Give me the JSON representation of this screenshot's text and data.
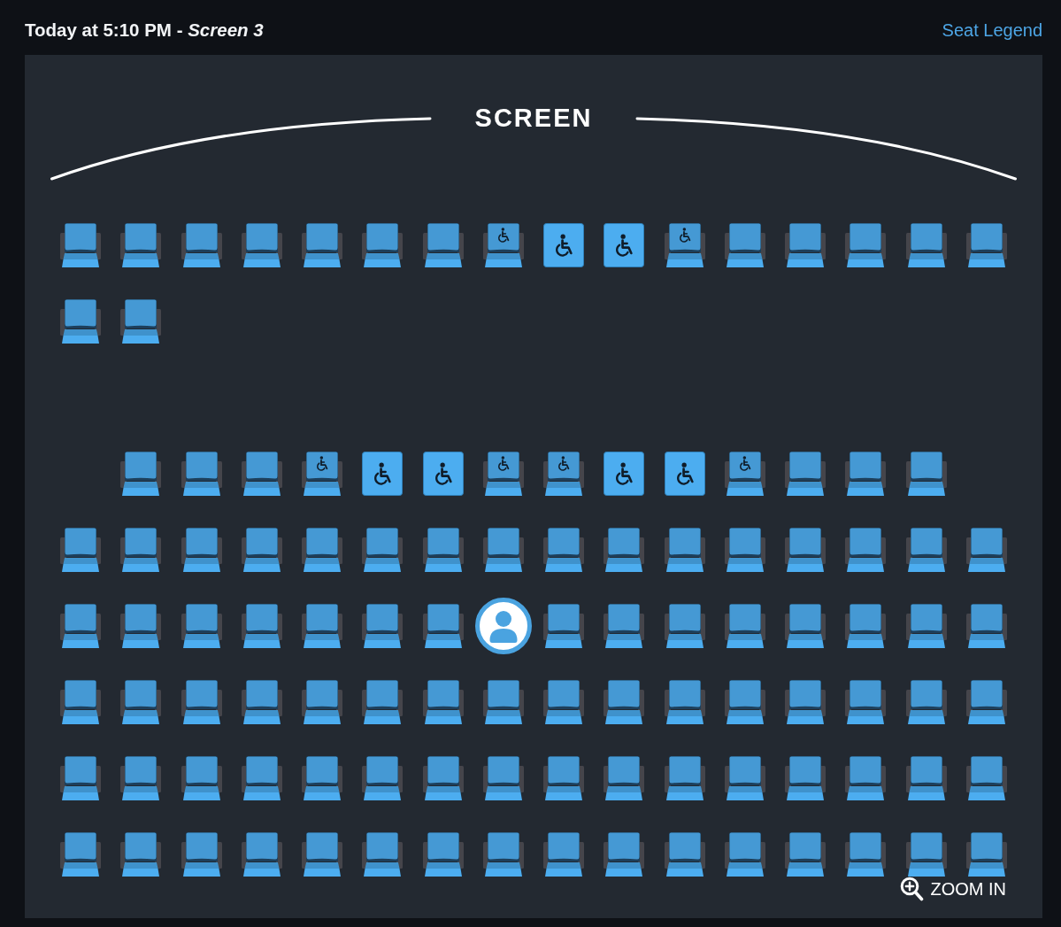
{
  "header": {
    "title": "Today at 5:10 PM - *Screen 3*",
    "legend_link": "Seat Legend"
  },
  "screen": {
    "label": "SCREEN"
  },
  "sections": [
    {
      "rows": [
        {
          "seats": [
            {
              "kind": "standard",
              "selected": false
            },
            {
              "kind": "standard",
              "selected": false
            },
            {
              "kind": "standard",
              "selected": false
            },
            {
              "kind": "standard",
              "selected": false
            },
            {
              "kind": "standard",
              "selected": false
            },
            {
              "kind": "standard",
              "selected": false
            },
            {
              "kind": "standard",
              "selected": false
            },
            {
              "kind": "companion",
              "selected": false
            },
            {
              "kind": "wheelchair",
              "selected": false
            },
            {
              "kind": "wheelchair",
              "selected": false
            },
            {
              "kind": "companion",
              "selected": false
            },
            {
              "kind": "standard",
              "selected": false
            },
            {
              "kind": "standard",
              "selected": false
            },
            {
              "kind": "standard",
              "selected": false
            },
            {
              "kind": "standard",
              "selected": false
            },
            {
              "kind": "standard",
              "selected": false
            }
          ]
        },
        {
          "seats": [
            {
              "kind": "standard",
              "selected": false
            },
            {
              "kind": "standard",
              "selected": false
            }
          ]
        }
      ]
    },
    {
      "rows": [
        {
          "seats": [
            {
              "kind": "empty"
            },
            {
              "kind": "standard",
              "selected": false
            },
            {
              "kind": "standard",
              "selected": false
            },
            {
              "kind": "standard",
              "selected": false
            },
            {
              "kind": "companion",
              "selected": false
            },
            {
              "kind": "wheelchair",
              "selected": false
            },
            {
              "kind": "wheelchair",
              "selected": false
            },
            {
              "kind": "companion",
              "selected": false
            },
            {
              "kind": "companion",
              "selected": false
            },
            {
              "kind": "wheelchair",
              "selected": false
            },
            {
              "kind": "wheelchair",
              "selected": false
            },
            {
              "kind": "companion",
              "selected": false
            },
            {
              "kind": "standard",
              "selected": false
            },
            {
              "kind": "standard",
              "selected": false
            },
            {
              "kind": "standard",
              "selected": false
            }
          ]
        },
        {
          "seats": [
            {
              "kind": "standard",
              "selected": false
            },
            {
              "kind": "standard",
              "selected": false
            },
            {
              "kind": "standard",
              "selected": false
            },
            {
              "kind": "standard",
              "selected": false
            },
            {
              "kind": "standard",
              "selected": false
            },
            {
              "kind": "standard",
              "selected": false
            },
            {
              "kind": "standard",
              "selected": false
            },
            {
              "kind": "standard",
              "selected": false
            },
            {
              "kind": "standard",
              "selected": false
            },
            {
              "kind": "standard",
              "selected": false
            },
            {
              "kind": "standard",
              "selected": false
            },
            {
              "kind": "standard",
              "selected": false
            },
            {
              "kind": "standard",
              "selected": false
            },
            {
              "kind": "standard",
              "selected": false
            },
            {
              "kind": "standard",
              "selected": false
            },
            {
              "kind": "standard",
              "selected": false
            }
          ]
        },
        {
          "seats": [
            {
              "kind": "standard",
              "selected": false
            },
            {
              "kind": "standard",
              "selected": false
            },
            {
              "kind": "standard",
              "selected": false
            },
            {
              "kind": "standard",
              "selected": false
            },
            {
              "kind": "standard",
              "selected": false
            },
            {
              "kind": "standard",
              "selected": false
            },
            {
              "kind": "standard",
              "selected": false
            },
            {
              "kind": "standard",
              "selected": true
            },
            {
              "kind": "standard",
              "selected": false
            },
            {
              "kind": "standard",
              "selected": false
            },
            {
              "kind": "standard",
              "selected": false
            },
            {
              "kind": "standard",
              "selected": false
            },
            {
              "kind": "standard",
              "selected": false
            },
            {
              "kind": "standard",
              "selected": false
            },
            {
              "kind": "standard",
              "selected": false
            },
            {
              "kind": "standard",
              "selected": false
            }
          ]
        },
        {
          "seats": [
            {
              "kind": "standard",
              "selected": false
            },
            {
              "kind": "standard",
              "selected": false
            },
            {
              "kind": "standard",
              "selected": false
            },
            {
              "kind": "standard",
              "selected": false
            },
            {
              "kind": "standard",
              "selected": false
            },
            {
              "kind": "standard",
              "selected": false
            },
            {
              "kind": "standard",
              "selected": false
            },
            {
              "kind": "standard",
              "selected": false
            },
            {
              "kind": "standard",
              "selected": false
            },
            {
              "kind": "standard",
              "selected": false
            },
            {
              "kind": "standard",
              "selected": false
            },
            {
              "kind": "standard",
              "selected": false
            },
            {
              "kind": "standard",
              "selected": false
            },
            {
              "kind": "standard",
              "selected": false
            },
            {
              "kind": "standard",
              "selected": false
            },
            {
              "kind": "standard",
              "selected": false
            }
          ]
        },
        {
          "seats": [
            {
              "kind": "standard",
              "selected": false
            },
            {
              "kind": "standard",
              "selected": false
            },
            {
              "kind": "standard",
              "selected": false
            },
            {
              "kind": "standard",
              "selected": false
            },
            {
              "kind": "standard",
              "selected": false
            },
            {
              "kind": "standard",
              "selected": false
            },
            {
              "kind": "standard",
              "selected": false
            },
            {
              "kind": "standard",
              "selected": false
            },
            {
              "kind": "standard",
              "selected": false
            },
            {
              "kind": "standard",
              "selected": false
            },
            {
              "kind": "standard",
              "selected": false
            },
            {
              "kind": "standard",
              "selected": false
            },
            {
              "kind": "standard",
              "selected": false
            },
            {
              "kind": "standard",
              "selected": false
            },
            {
              "kind": "standard",
              "selected": false
            },
            {
              "kind": "standard",
              "selected": false
            }
          ]
        },
        {
          "seats": [
            {
              "kind": "standard",
              "selected": false
            },
            {
              "kind": "standard",
              "selected": false
            },
            {
              "kind": "standard",
              "selected": false
            },
            {
              "kind": "standard",
              "selected": false
            },
            {
              "kind": "standard",
              "selected": false
            },
            {
              "kind": "standard",
              "selected": false
            },
            {
              "kind": "standard",
              "selected": false
            },
            {
              "kind": "standard",
              "selected": false
            },
            {
              "kind": "standard",
              "selected": false
            },
            {
              "kind": "standard",
              "selected": false
            },
            {
              "kind": "standard",
              "selected": false
            },
            {
              "kind": "standard",
              "selected": false
            },
            {
              "kind": "standard",
              "selected": false
            },
            {
              "kind": "standard",
              "selected": false
            },
            {
              "kind": "standard",
              "selected": false
            },
            {
              "kind": "standard",
              "selected": false
            }
          ]
        }
      ]
    }
  ],
  "zoom_button": {
    "label": "ZOOM IN"
  }
}
